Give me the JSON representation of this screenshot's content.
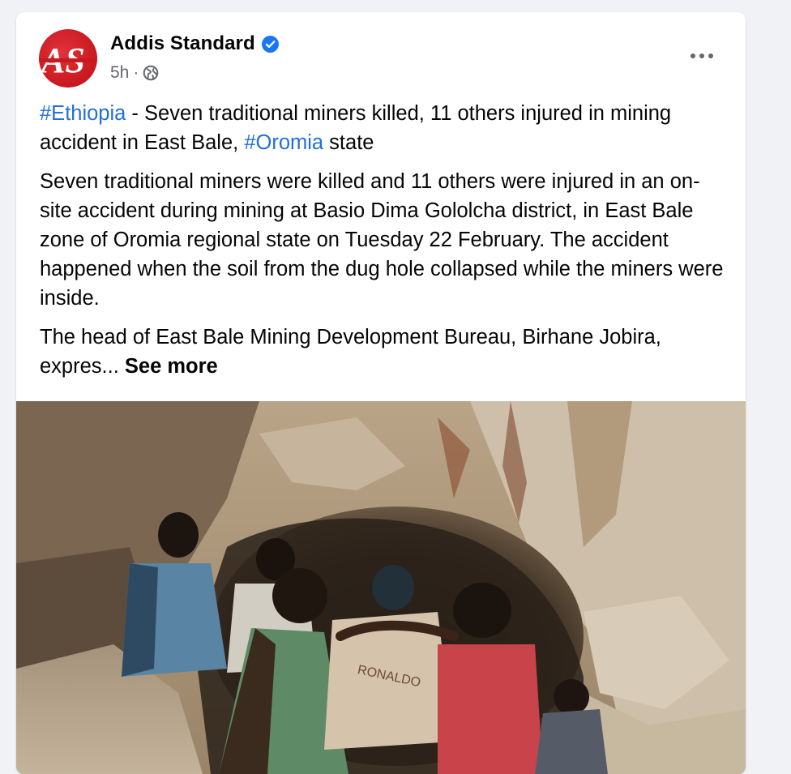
{
  "post": {
    "page_name": "Addis Standard",
    "avatar_text": "AS",
    "time": "5h",
    "separator": "·",
    "privacy_icon": "globe-icon",
    "verified_icon": "verified-badge-icon",
    "more_icon": "more-options-icon",
    "headline": {
      "hashtag1": "#Ethiopia",
      "text1": " - Seven traditional miners killed, 11 others injured in mining accident in East Bale, ",
      "hashtag2": "#Oromia",
      "text2": " state"
    },
    "body_paragraph": "Seven traditional miners were killed and 11 others were injured in an on-site accident during mining at Basio Dima Gololcha district, in East Bale zone of Oromia regional state on Tuesday 22 February. The accident happened when the soil from the dug hole collapsed while the miners were inside.",
    "truncated_paragraph": "The head of East Bale Mining Development Bureau, Birhane Jobira, expres...",
    "see_more_label": "See more",
    "photo_shirt_text": "RONALDO"
  },
  "colors": {
    "hashtag": "#216fdb",
    "brand_red": "#c8191f",
    "verified_blue": "#1877f2",
    "secondary_text": "#65676b"
  }
}
